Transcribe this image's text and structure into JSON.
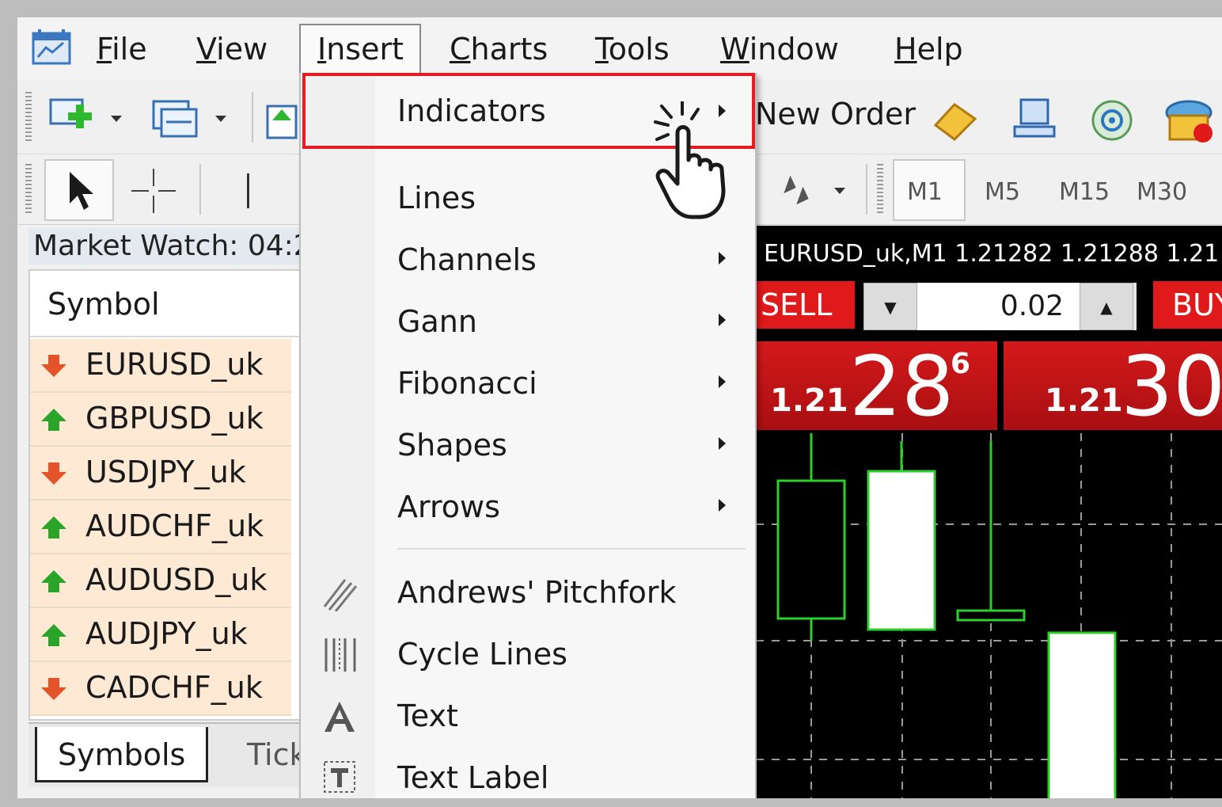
{
  "menubar": {
    "items": [
      {
        "label": "File",
        "underline": "F",
        "rest": "ile"
      },
      {
        "label": "View",
        "underline": "V",
        "rest": "iew"
      },
      {
        "label": "Insert",
        "underline": "I",
        "rest": "nsert"
      },
      {
        "label": "Charts",
        "underline": "C",
        "rest": "harts"
      },
      {
        "label": "Tools",
        "underline": "T",
        "rest": "ools"
      },
      {
        "label": "Window",
        "underline": "W",
        "rest": "indow"
      },
      {
        "label": "Help",
        "underline": "H",
        "rest": "elp"
      }
    ],
    "active": "Insert"
  },
  "toolbar": {
    "new_order_label": "New Order",
    "timeframes": [
      "M1",
      "M5",
      "M15",
      "M30"
    ]
  },
  "market_watch": {
    "title": "Market Watch: 04:2",
    "column_header": "Symbol",
    "rows": [
      {
        "symbol": "EURUSD_uk",
        "direction": "down"
      },
      {
        "symbol": "GBPUSD_uk",
        "direction": "up"
      },
      {
        "symbol": "USDJPY_uk",
        "direction": "down"
      },
      {
        "symbol": "AUDCHF_uk",
        "direction": "up"
      },
      {
        "symbol": "AUDUSD_uk",
        "direction": "up"
      },
      {
        "symbol": "AUDJPY_uk",
        "direction": "up"
      },
      {
        "symbol": "CADCHF_uk",
        "direction": "down"
      }
    ],
    "tabs": [
      "Symbols",
      "Tick"
    ]
  },
  "chart": {
    "title": "EURUSD_uk,M1  1.21282 1.21288 1.21",
    "sell_label": "SELL",
    "buy_label": "BUY",
    "lot_value": "0.02",
    "sell_price": {
      "prefix": "1.21",
      "big": "28",
      "sup": "6"
    },
    "buy_price": {
      "prefix": "1.21",
      "big": "30"
    }
  },
  "insert_menu": {
    "items": [
      {
        "label": "Indicators",
        "submenu": true,
        "highlighted": true
      },
      {
        "label": "Lines",
        "submenu": false
      },
      {
        "label": "Channels",
        "submenu": true
      },
      {
        "label": "Gann",
        "submenu": true
      },
      {
        "label": "Fibonacci",
        "submenu": true
      },
      {
        "label": "Shapes",
        "submenu": true
      },
      {
        "label": "Arrows",
        "submenu": true
      },
      {
        "label": "Andrews' Pitchfork",
        "icon": "pitchfork-icon"
      },
      {
        "label": "Cycle Lines",
        "icon": "cycle-lines-icon"
      },
      {
        "label": "Text",
        "icon": "text-icon"
      },
      {
        "label": "Text Label",
        "icon": "text-label-icon"
      }
    ]
  },
  "colors": {
    "highlight": "#e61c24",
    "sell_red": "#e0191b",
    "up_arrow": "#2aa52a",
    "down_arrow": "#e5532b",
    "candle_green": "#2bd12b"
  }
}
